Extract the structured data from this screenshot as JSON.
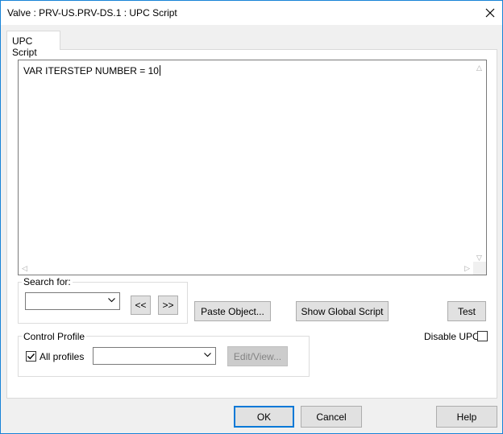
{
  "window": {
    "title": "Valve : PRV-US.PRV-DS.1 : UPC Script"
  },
  "tabs": [
    {
      "label": "UPC Script",
      "active": true
    }
  ],
  "script_editor": {
    "content": "VAR ITERSTEP NUMBER = 10"
  },
  "search": {
    "group_label": "Search for:",
    "value": "",
    "prev_label": "<<",
    "next_label": ">>"
  },
  "buttons": {
    "paste_object": "Paste Object...",
    "show_global_script": "Show Global Script",
    "test": "Test",
    "ok": "OK",
    "cancel": "Cancel",
    "help": "Help"
  },
  "disable_upc": {
    "label": "Disable UPC",
    "checked": false
  },
  "control_profile": {
    "group_label": "Control Profile",
    "all_profiles_label": "All profiles",
    "all_profiles_checked": true,
    "selected_profile": "",
    "edit_view_label": "Edit/View..."
  },
  "colors": {
    "window_border": "#1883d7",
    "default_button_border": "#0078d7",
    "dialog_background": "#f0f0f0"
  },
  "icons": {
    "close": "close-icon",
    "dropdown": "chevron-down-icon",
    "check": "checkmark-icon"
  }
}
